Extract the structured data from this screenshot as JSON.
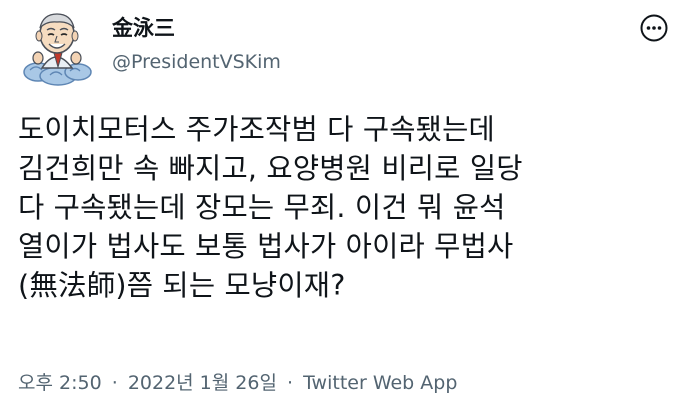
{
  "tweet": {
    "author": {
      "display_name": "金泳三",
      "handle": "@PresidentVSKim"
    },
    "text_lines": [
      "도이치모터스 주가조작범 다 구속됐는데",
      "김건희만 속 빠지고, 요양병원 비리로 일당",
      "다 구속됐는데 장모는 무죄. 이건 뭐 윤석",
      "열이가 법사도 보통 법사가 아이라 무법사",
      "(無法師)쯤 되는 모냥이재?"
    ],
    "meta": {
      "time": "오후 2:50",
      "separator": "·",
      "date": "2022년 1월 26일",
      "source": "Twitter Web App"
    }
  },
  "icons": {
    "avatar": "cartoon-portrait-avatar",
    "more": "more-options-icon"
  },
  "colors": {
    "text_primary": "#0f1419",
    "text_secondary": "#536471",
    "background": "#ffffff"
  }
}
